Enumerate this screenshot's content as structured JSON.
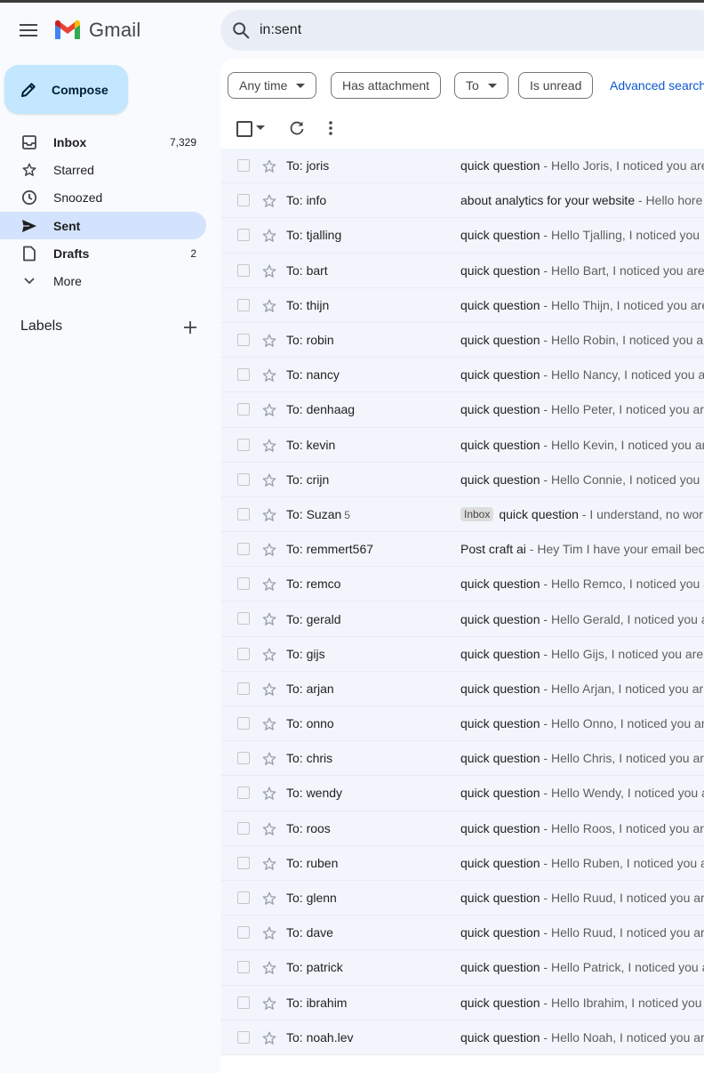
{
  "app": {
    "name": "Gmail"
  },
  "search": {
    "query": "in:sent"
  },
  "compose": {
    "label": "Compose"
  },
  "nav": [
    {
      "label": "Inbox",
      "count": "7,329",
      "icon": "inbox-icon",
      "bold": true
    },
    {
      "label": "Starred",
      "count": "",
      "icon": "star-icon"
    },
    {
      "label": "Snoozed",
      "count": "",
      "icon": "clock-icon"
    },
    {
      "label": "Sent",
      "count": "",
      "icon": "send-icon",
      "active": true,
      "bold": true
    },
    {
      "label": "Drafts",
      "count": "2",
      "icon": "draft-icon",
      "bold": true
    },
    {
      "label": "More",
      "count": "",
      "icon": "chevron-down-icon"
    }
  ],
  "labels": {
    "title": "Labels"
  },
  "filters": {
    "any_time": "Any time",
    "has_attachment": "Has attachment",
    "to": "To",
    "is_unread": "Is unread",
    "advanced": "Advanced search"
  },
  "emails": [
    {
      "to": "To: joris",
      "subject": "quick question",
      "snippet": " - Hello Joris, I noticed you are"
    },
    {
      "to": "To: info",
      "subject": "about analytics for your website",
      "snippet": " - Hello hore"
    },
    {
      "to": "To: tjalling",
      "subject": "quick question",
      "snippet": " - Hello Tjalling, I noticed you"
    },
    {
      "to": "To: bart",
      "subject": "quick question",
      "snippet": " - Hello Bart, I noticed you are"
    },
    {
      "to": "To: thijn",
      "subject": "quick question",
      "snippet": " - Hello Thijn, I noticed you are"
    },
    {
      "to": "To: robin",
      "subject": "quick question",
      "snippet": " - Hello Robin, I noticed you ar"
    },
    {
      "to": "To: nancy",
      "subject": "quick question",
      "snippet": " - Hello Nancy, I noticed you a"
    },
    {
      "to": "To: denhaag",
      "subject": "quick question",
      "snippet": " - Hello Peter, I noticed you ar"
    },
    {
      "to": "To: kevin",
      "subject": "quick question",
      "snippet": " - Hello Kevin, I noticed you ar"
    },
    {
      "to": "To: crijn",
      "subject": "quick question",
      "snippet": " - Hello Connie, I noticed you"
    },
    {
      "to": "To: Suzan",
      "thread_count": "5",
      "badge": "Inbox",
      "subject": "quick question",
      "snippet": " - I understand, no wor"
    },
    {
      "to": "To: remmert567",
      "subject": "Post craft ai",
      "snippet": " - Hey Tim I have your email beca"
    },
    {
      "to": "To: remco",
      "subject": "quick question",
      "snippet": " - Hello Remco, I noticed you a"
    },
    {
      "to": "To: gerald",
      "subject": "quick question",
      "snippet": " - Hello Gerald, I noticed you a"
    },
    {
      "to": "To: gijs",
      "subject": "quick question",
      "snippet": " - Hello Gijs, I noticed you are"
    },
    {
      "to": "To: arjan",
      "subject": "quick question",
      "snippet": " - Hello Arjan, I noticed you ar"
    },
    {
      "to": "To: onno",
      "subject": "quick question",
      "snippet": " - Hello Onno, I noticed you ar"
    },
    {
      "to": "To: chris",
      "subject": "quick question",
      "snippet": " - Hello Chris, I noticed you ar"
    },
    {
      "to": "To: wendy",
      "subject": "quick question",
      "snippet": " - Hello Wendy, I noticed you a"
    },
    {
      "to": "To: roos",
      "subject": "quick question",
      "snippet": " - Hello Roos, I noticed you are"
    },
    {
      "to": "To: ruben",
      "subject": "quick question",
      "snippet": " - Hello Ruben, I noticed you a"
    },
    {
      "to": "To: glenn",
      "subject": "quick question",
      "snippet": " - Hello Ruud, I noticed you ar"
    },
    {
      "to": "To: dave",
      "subject": "quick question",
      "snippet": " - Hello Ruud, I noticed you ar"
    },
    {
      "to": "To: patrick",
      "subject": "quick question",
      "snippet": " - Hello Patrick, I noticed you a"
    },
    {
      "to": "To: ibrahim",
      "subject": "quick question",
      "snippet": " - Hello Ibrahim, I noticed you"
    },
    {
      "to": "To: noah.lev",
      "subject": "quick question",
      "snippet": " - Hello Noah, I noticed you ar"
    }
  ],
  "colors": {
    "accent": "#0b57d0",
    "active_nav": "#d3e3fd",
    "compose_bg": "#c2e7ff"
  }
}
